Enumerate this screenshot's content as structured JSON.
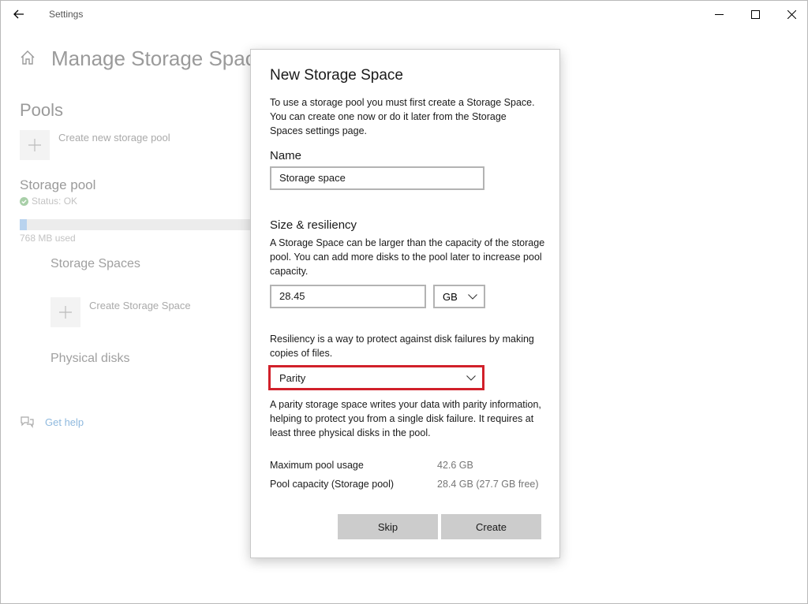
{
  "window": {
    "title": "Settings"
  },
  "background": {
    "page_title": "Manage Storage Spaces",
    "pools_heading": "Pools",
    "create_pool_label": "Create new storage pool",
    "pool_name": "Storage pool",
    "pool_status": "Status: OK",
    "pool_used": "768 MB used",
    "pool_usage_fraction": 0.03,
    "spaces_heading": "Storage Spaces",
    "create_space_label": "Create Storage Space",
    "disks_heading": "Physical disks",
    "help_label": "Get help"
  },
  "dialog": {
    "title": "New Storage Space",
    "intro": "To use a storage pool you must first create a Storage Space. You can create one now or do it later from the Storage Spaces settings page.",
    "name_label": "Name",
    "name_value": "Storage space",
    "size_heading": "Size & resiliency",
    "size_desc": "A Storage Space can be larger than the capacity of the storage pool. You can add more disks to the pool later to increase pool capacity.",
    "size_value": "28.45",
    "unit_value": "GB",
    "resiliency_desc": "Resiliency is a way to protect against disk failures by making copies of files.",
    "resiliency_value": "Parity",
    "parity_desc": "A parity storage space writes your data with parity information, helping to protect you from a single disk failure. It requires at least three physical disks in the pool.",
    "max_usage_label": "Maximum pool usage",
    "max_usage_value": "42.6 GB",
    "capacity_label": "Pool capacity (Storage pool)",
    "capacity_value": "28.4 GB (27.7 GB free)",
    "skip_label": "Skip",
    "create_label": "Create"
  },
  "colors": {
    "highlight_border": "#d1202a",
    "button_bg": "#cccccc",
    "link": "#8fb9de"
  }
}
